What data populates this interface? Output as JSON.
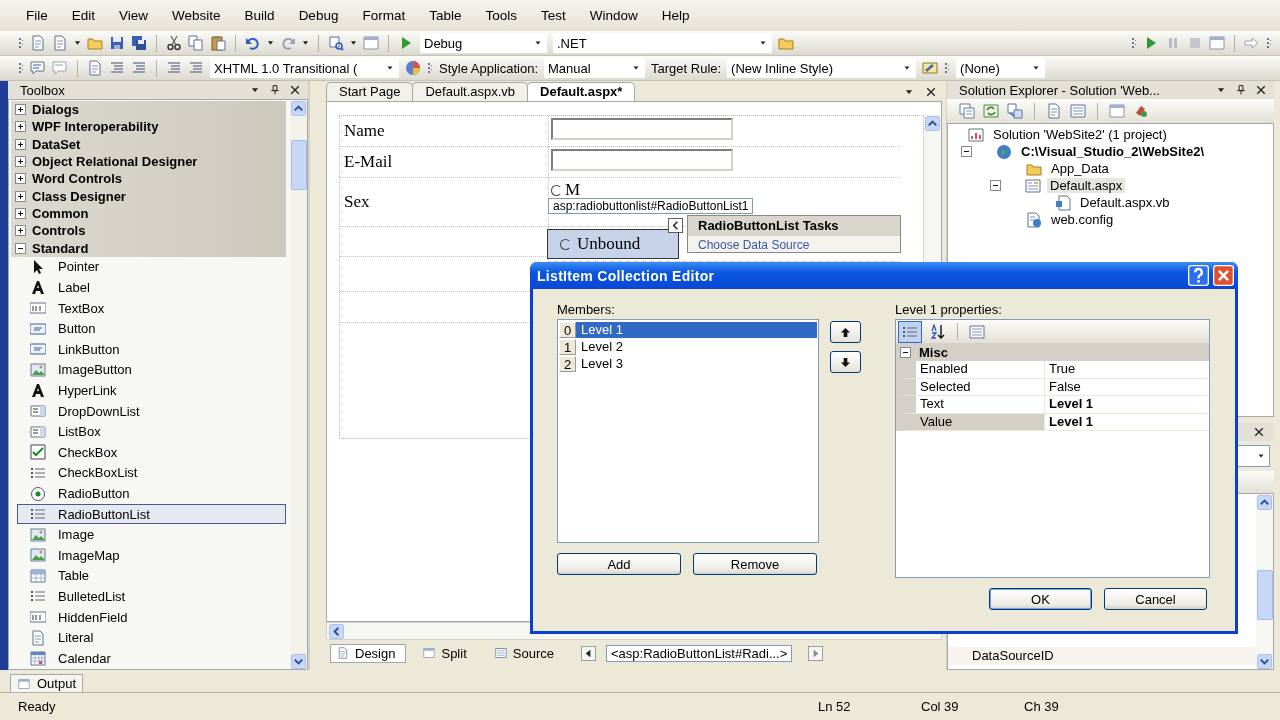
{
  "menu": [
    "File",
    "Edit",
    "View",
    "Website",
    "Build",
    "Debug",
    "Format",
    "Table",
    "Tools",
    "Test",
    "Window",
    "Help"
  ],
  "toolbar_standard": {
    "configuration": "Debug",
    "platform": ".NET"
  },
  "toolbar_formatting": {
    "doctype": "XHTML 1.0 Transitional (",
    "style_application_label": "Style Application:",
    "style_application": "Manual",
    "target_rule_label": "Target Rule:",
    "target_rule": "(New Inline Style)",
    "font": "(None)"
  },
  "toolbox": {
    "title": "Toolbox",
    "categories": [
      {
        "label": "Dialogs",
        "expanded": false
      },
      {
        "label": "WPF Interoperability",
        "expanded": false
      },
      {
        "label": "DataSet",
        "expanded": false
      },
      {
        "label": "Object Relational Designer",
        "expanded": false
      },
      {
        "label": "Word Controls",
        "expanded": false
      },
      {
        "label": "Class Designer",
        "expanded": false
      },
      {
        "label": "Common",
        "expanded": false
      },
      {
        "label": "Controls",
        "expanded": false
      },
      {
        "label": "Standard",
        "expanded": true,
        "items": [
          {
            "label": "Pointer",
            "selected": false
          },
          {
            "label": "Label",
            "selected": false
          },
          {
            "label": "TextBox",
            "selected": false
          },
          {
            "label": "Button",
            "selected": false
          },
          {
            "label": "LinkButton",
            "selected": false
          },
          {
            "label": "ImageButton",
            "selected": false
          },
          {
            "label": "HyperLink",
            "selected": false
          },
          {
            "label": "DropDownList",
            "selected": false
          },
          {
            "label": "ListBox",
            "selected": false
          },
          {
            "label": "CheckBox",
            "selected": false
          },
          {
            "label": "CheckBoxList",
            "selected": false
          },
          {
            "label": "RadioButton",
            "selected": false
          },
          {
            "label": "RadioButtonList",
            "selected": true
          },
          {
            "label": "Image",
            "selected": false
          },
          {
            "label": "ImageMap",
            "selected": false
          },
          {
            "label": "Table",
            "selected": false
          },
          {
            "label": "BulletedList",
            "selected": false
          },
          {
            "label": "HiddenField",
            "selected": false
          },
          {
            "label": "Literal",
            "selected": false
          },
          {
            "label": "Calendar",
            "selected": false
          }
        ]
      }
    ]
  },
  "document_tabs": [
    {
      "label": "Start Page",
      "selected": false
    },
    {
      "label": "Default.aspx.vb",
      "selected": false
    },
    {
      "label": "Default.aspx*",
      "selected": true
    }
  ],
  "design_surface": {
    "rows": [
      {
        "label": "Name",
        "kind": "textbox"
      },
      {
        "label": "E-Mail",
        "kind": "textbox"
      },
      {
        "label": "Sex",
        "kind": "radio",
        "options": [
          "M"
        ]
      }
    ],
    "tag_label": "asp:radiobuttonlist#RadioButtonList1",
    "selected_control_option": "Unbound",
    "smart_tag": {
      "title": "RadioButtonList Tasks",
      "tasks": [
        "Choose Data Source"
      ]
    }
  },
  "view_tabs": [
    {
      "label": "Design",
      "selected": true
    },
    {
      "label": "Split",
      "selected": false
    },
    {
      "label": "Source",
      "selected": false
    }
  ],
  "tag_navigator": "<asp:RadioButtonList#Radi...>",
  "solution_explorer": {
    "title": "Solution Explorer - Solution 'Web...",
    "tree": [
      {
        "label": "Solution 'WebSite2' (1 project)",
        "kind": "solution",
        "selected": false,
        "children": [
          {
            "label": "C:\\Visual_Studio_2\\WebSite2\\",
            "kind": "project",
            "selected": false,
            "expanded": true,
            "children": [
              {
                "label": "App_Data",
                "kind": "folder",
                "selected": false
              },
              {
                "label": "Default.aspx",
                "kind": "page",
                "selected": true,
                "expanded": true,
                "children": [
                  {
                    "label": "Default.aspx.vb",
                    "kind": "code",
                    "selected": false
                  }
                ]
              },
              {
                "label": "web.config",
                "kind": "config",
                "selected": false
              }
            ]
          }
        ]
      }
    ]
  },
  "properties": {
    "rows": [
      "DataSourceID"
    ]
  },
  "output_tab": "Output",
  "status_bar": {
    "message": "Ready",
    "line": "Ln 52",
    "column": "Col 39",
    "char": "Ch 39"
  },
  "dialog": {
    "title": "ListItem Collection Editor",
    "members_label": "Members:",
    "members": [
      {
        "index": "0",
        "label": "Level 1",
        "selected": true
      },
      {
        "index": "1",
        "label": "Level 2",
        "selected": false
      },
      {
        "index": "2",
        "label": "Level 3",
        "selected": false
      }
    ],
    "add": "Add",
    "remove": "Remove",
    "properties_label": "Level 1 properties:",
    "category": {
      "label": "Misc",
      "expanded": true
    },
    "properties": [
      {
        "name": "Enabled",
        "value": "True",
        "modified": false,
        "selected": false
      },
      {
        "name": "Selected",
        "value": "False",
        "modified": false,
        "selected": false
      },
      {
        "name": "Text",
        "value": "Level 1",
        "modified": true,
        "selected": false
      },
      {
        "name": "Value",
        "value": "Level 1",
        "modified": true,
        "selected": true
      }
    ],
    "ok": "OK",
    "cancel": "Cancel"
  }
}
